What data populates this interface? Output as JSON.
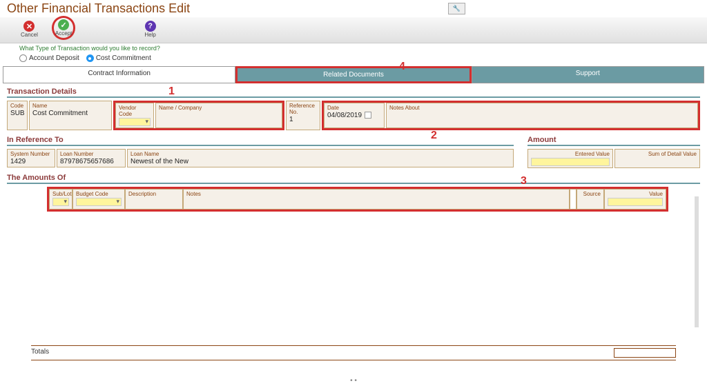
{
  "page_title": "Other Financial Transactions Edit",
  "toolbar": {
    "cancel": "Cancel",
    "accept": "Accept",
    "help": "Help"
  },
  "prompt": "What Type of Transaction would you like to record?",
  "radios": {
    "account_deposit": "Account Deposit",
    "cost_commitment": "Cost Commitment"
  },
  "tabs": {
    "contract": "Contract Information",
    "related": "Related Documents",
    "support": "Support"
  },
  "sections": {
    "transaction_details": "Transaction Details",
    "in_reference_to": "In Reference To",
    "amount": "Amount",
    "the_amounts_of": "The Amounts Of"
  },
  "td": {
    "code_label": "Code",
    "code_value": "SUB",
    "name_label": "Name",
    "name_value": "Cost Commitment",
    "vendor_code_label": "Vendor Code",
    "name_company_label": "Name / Company",
    "reference_no_label": "Reference No.",
    "reference_no_value": "1",
    "date_label": "Date",
    "date_value": "04/08/2019",
    "notes_about_label": "Notes About"
  },
  "ref": {
    "system_number_label": "System Number",
    "system_number_value": "1429",
    "loan_number_label": "Loan Number",
    "loan_number_value": "87978675657686",
    "loan_name_label": "Loan Name",
    "loan_name_value": "Newest of the New"
  },
  "amount": {
    "entered_value_label": "Entered Value",
    "sum_of_detail_label": "Sum of Detail Value"
  },
  "amounts_of": {
    "sublot": "Sub/Lot",
    "budget_code": "Budget Code",
    "description": "Description",
    "notes": "Notes",
    "source": "Source",
    "value": "Value"
  },
  "totals": "Totals",
  "annotations": {
    "a1": "1",
    "a2": "2",
    "a3": "3",
    "a4": "4"
  }
}
